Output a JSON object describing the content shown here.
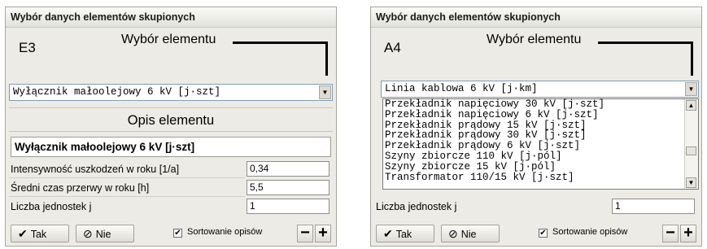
{
  "left": {
    "title": "Wybór danych elementów skupionych",
    "code": "E3",
    "element_header": "Wybór elementu",
    "combo_value": "Wyłącznik małoolejowy 6 kV [j·szt]",
    "desc_header": "Opis elementu",
    "desc_value": "Wyłącznik małoolejowy 6 kV [j·szt]",
    "rows": [
      {
        "label": "Intensywność uszkodzeń w roku [1/a]",
        "value": "0,34"
      },
      {
        "label": "Średni czas przerwy w roku [h]",
        "value": "5,5"
      },
      {
        "label": "Liczba jednostek j",
        "value": "1"
      }
    ],
    "ok_label": "Tak",
    "cancel_label": "Nie",
    "sort_label": "Sortowanie opisów",
    "sort_checked": "✔",
    "minus_label": "−",
    "plus_label": "+"
  },
  "right": {
    "title": "Wybór danych elementów skupionych",
    "code": "A4",
    "element_header": "Wybór elementu",
    "combo_value": "Linia kablowa 6 kV [j·km]",
    "dropdown_items": [
      "Przekładnik napięciowy 30 kV [j·szt]",
      "Przekładnik napięciowy 6 kV [j·szt]",
      "Przekładnik prądowy 15 kV [j·szt]",
      "Przekładnik prądowy 30 kV [j·szt]",
      "Przekładnik prądowy 6 kV [j·szt]",
      "Szyny zbiorcze 110 kV [j·pól]",
      "Szyny zbiorcze 15 kV [j·pól]",
      "Transformator 110/15 kV [j·szt]"
    ],
    "rows": [
      {
        "label": "Liczba jednostek j",
        "value": "1"
      }
    ],
    "ok_label": "Tak",
    "cancel_label": "Nie",
    "sort_label": "Sortowanie opisów",
    "sort_checked": "✔",
    "minus_label": "−",
    "plus_label": "+"
  },
  "icons": {
    "ok": "checkmark-icon",
    "cancel": "cancel-circle-icon",
    "combo_arrow": "chevron-down-icon"
  }
}
